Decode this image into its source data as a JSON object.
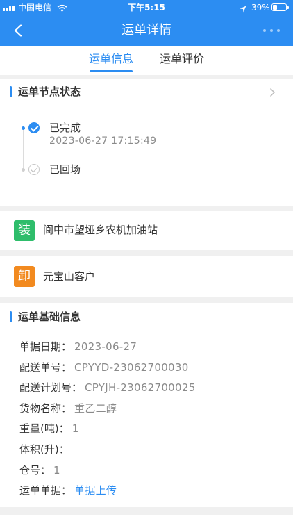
{
  "status_bar": {
    "carrier": "中国电信",
    "time": "下午5:15",
    "battery_text": "39%",
    "battery_level": 0.39
  },
  "nav": {
    "title": "运单详情"
  },
  "tabs": {
    "items": [
      "运单信息",
      "运单评价"
    ],
    "active_index": 0
  },
  "node_status": {
    "title": "运单节点状态",
    "nodes": [
      {
        "label": "已完成",
        "time": "2023-06-27 17:15:49",
        "active": true
      },
      {
        "label": "已回场",
        "active": false
      }
    ]
  },
  "loading": {
    "badge": "装",
    "name": "阆中市望垭乡农机加油站"
  },
  "unloading": {
    "badge": "卸",
    "name": "元宝山客户"
  },
  "basic_info": {
    "title": "运单基础信息",
    "rows": [
      {
        "label": "单据日期：",
        "value": "2023-06-27"
      },
      {
        "label": "配送单号：",
        "value": "CPYYD-23062700030"
      },
      {
        "label": "配送计划号：",
        "value": "CPYJH-23062700025"
      },
      {
        "label": "货物名称：",
        "value": "重乙二醇"
      },
      {
        "label": "重量(吨)：",
        "value": "1"
      },
      {
        "label": "体积(升)：",
        "value": ""
      },
      {
        "label": "仓号：",
        "value": "1"
      },
      {
        "label": "运单单据：",
        "value": "单据上传",
        "link": true
      }
    ]
  },
  "icons": {
    "back": "chevron-left-icon",
    "more": "more-icon",
    "expand": "chevron-right-icon",
    "node_done": "check-circle-icon",
    "signal": "cellular-signal-icon",
    "wifi": "wifi-icon",
    "location": "location-arrow-icon",
    "battery": "battery-icon"
  },
  "colors": {
    "accent": "#2c8df2",
    "load_badge": "#2ebd6b",
    "unload_badge": "#f28a1f",
    "page_background": "#f0f0f0"
  }
}
